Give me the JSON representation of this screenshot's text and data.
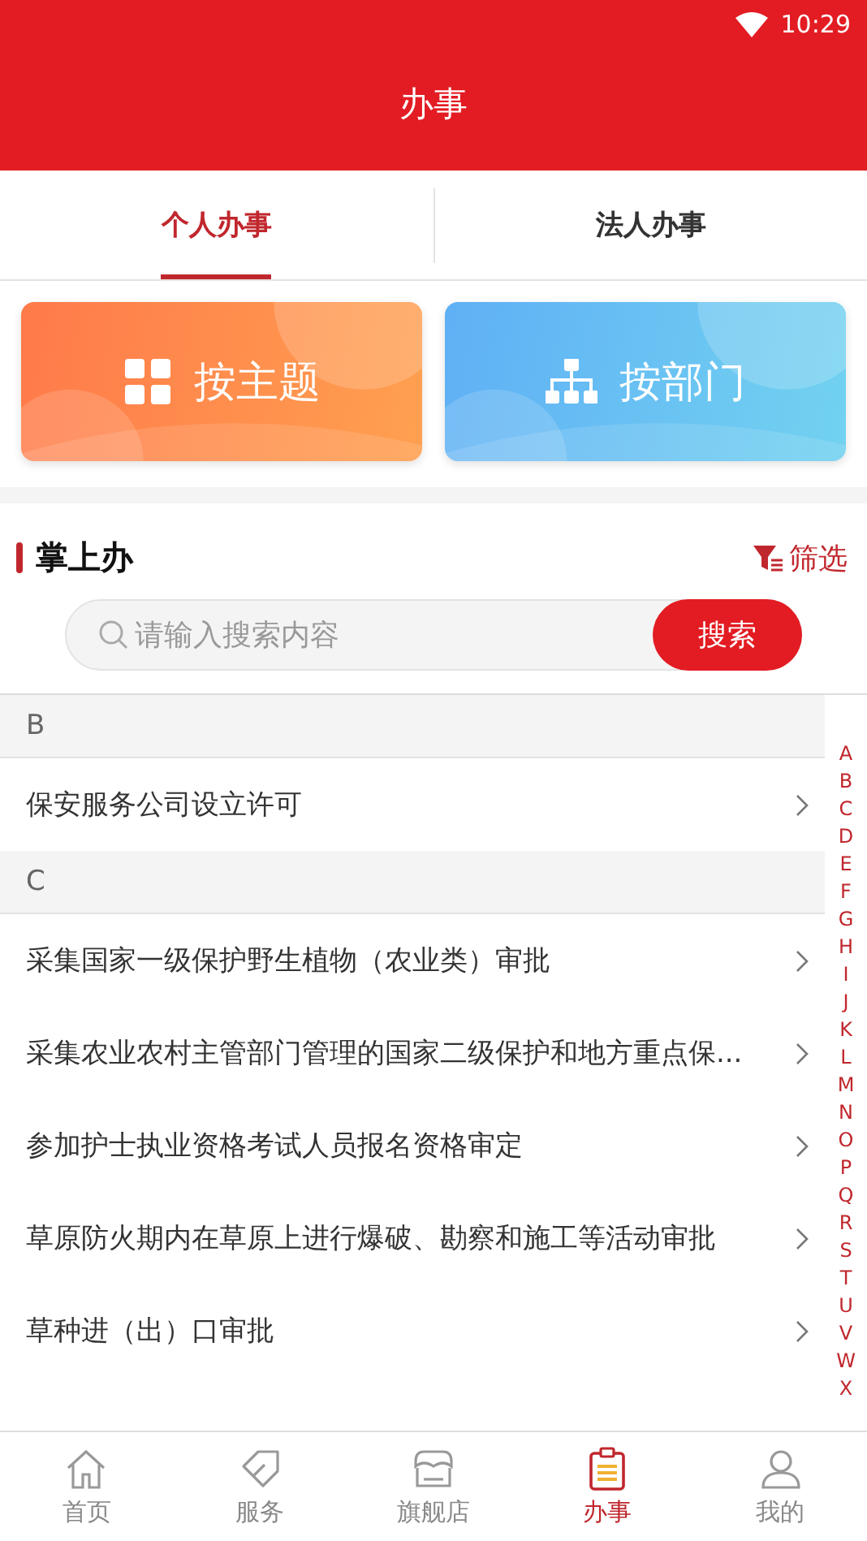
{
  "status_bar": {
    "time": "10:29"
  },
  "header": {
    "title": "办事"
  },
  "tabs": [
    {
      "label": "个人办事",
      "selected": true
    },
    {
      "label": "法人办事",
      "selected": false
    }
  ],
  "category_cards": [
    {
      "label": "按主题",
      "kind": "theme"
    },
    {
      "label": "按部门",
      "kind": "department"
    }
  ],
  "section": {
    "title": "掌上办",
    "filter": "筛选"
  },
  "search": {
    "placeholder": "请输入搜索内容",
    "button": "搜索"
  },
  "groups": [
    {
      "letter": "B",
      "items": [
        "保安服务公司设立许可"
      ]
    },
    {
      "letter": "C",
      "items": [
        "采集国家一级保护野生植物（农业类）审批",
        "采集农业农村主管部门管理的国家二级保护和地方重点保...",
        "参加护士执业资格考试人员报名资格审定",
        "草原防火期内在草原上进行爆破、勘察和施工等活动审批",
        "草种进（出）口审批"
      ]
    }
  ],
  "index_letters": [
    "A",
    "B",
    "C",
    "D",
    "E",
    "F",
    "G",
    "H",
    "I",
    "J",
    "K",
    "L",
    "M",
    "N",
    "O",
    "P",
    "Q",
    "R",
    "S",
    "T",
    "U",
    "V",
    "W",
    "X"
  ],
  "bottom_nav": [
    {
      "label": "首页",
      "selected": false
    },
    {
      "label": "服务",
      "selected": false
    },
    {
      "label": "旗舰店",
      "selected": false
    },
    {
      "label": "办事",
      "selected": true
    },
    {
      "label": "我的",
      "selected": false
    }
  ]
}
